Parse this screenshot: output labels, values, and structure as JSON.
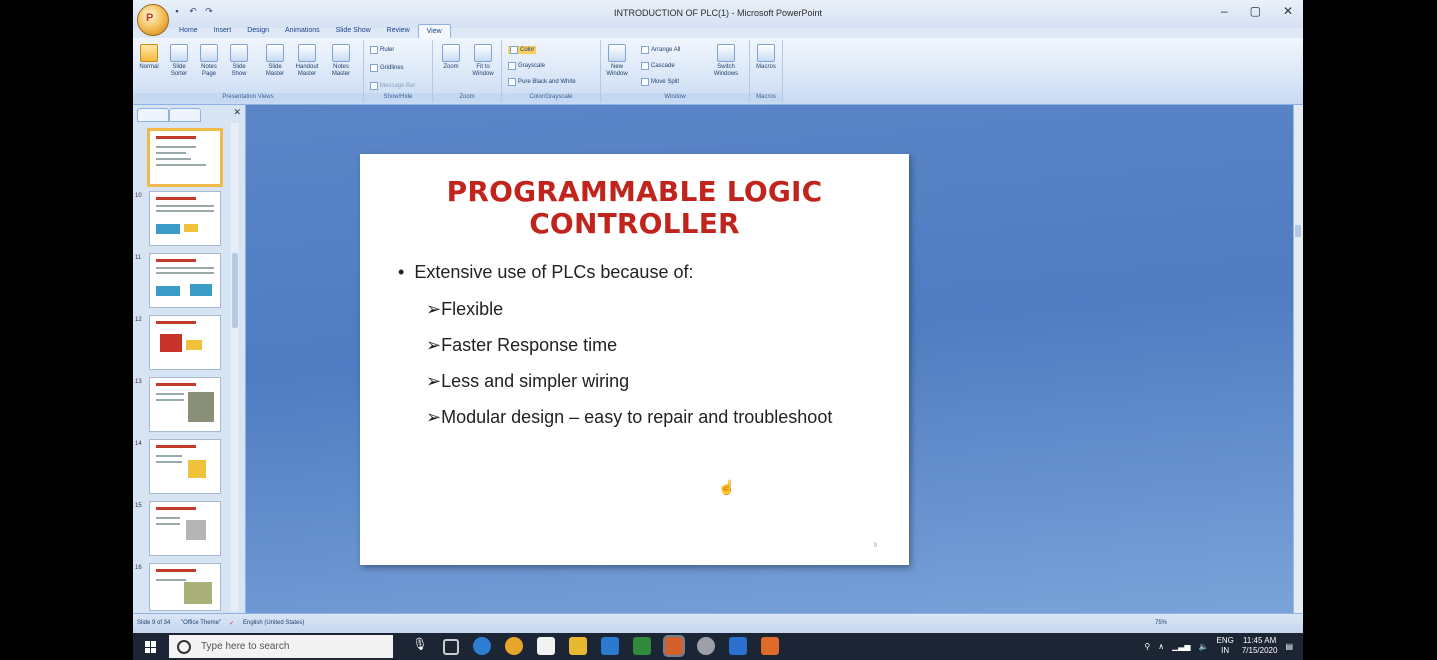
{
  "window": {
    "title": "INTRODUCTION OF PLC(1) - Microsoft PowerPoint",
    "controls": [
      "–",
      "▢",
      "✕"
    ]
  },
  "office_button_label": "P",
  "tabs": [
    "Home",
    "Insert",
    "Design",
    "Animations",
    "Slide Show",
    "Review",
    "View"
  ],
  "ribbon": {
    "presentation_views": {
      "label": "Presentation Views",
      "buttons": [
        "Normal",
        "Slide Sorter",
        "Notes Page",
        "Slide Show",
        "Slide Master",
        "Handout Master",
        "Notes Master"
      ]
    },
    "show_hide": {
      "label": "Show/Hide",
      "items": [
        "Ruler",
        "Gridlines",
        "Message Bar"
      ]
    },
    "zoom": {
      "label": "Zoom",
      "buttons": [
        "Zoom",
        "Fit to Window"
      ]
    },
    "color": {
      "label": "Color/Grayscale",
      "items": [
        "Color",
        "Grayscale",
        "Pure Black and White"
      ]
    },
    "window": {
      "label": "Window",
      "buttons": [
        "New Window",
        "Switch Windows"
      ],
      "items": [
        "Arrange All",
        "Cascade",
        "Move Split"
      ]
    },
    "macros": {
      "label": "Macros",
      "buttons": [
        "Macros"
      ]
    }
  },
  "slide_panel": {
    "thumb_numbers": [
      "",
      "10",
      "11",
      "12",
      "13",
      "14",
      "15",
      "16"
    ]
  },
  "slide": {
    "title": "PROGRAMMABLE LOGIC CONTROLLER",
    "bullet": "Extensive use of PLCs because of:",
    "subpoints": [
      "➢Flexible",
      "➢Faster Response time",
      "➢Less and simpler wiring",
      "➢Modular design – easy to repair and troubleshoot"
    ],
    "number": "9"
  },
  "status_bar": {
    "slide_info": "Slide 9 of 34",
    "theme": "\"Office Theme\"",
    "language": "English (United States)",
    "zoom": "75%"
  },
  "taskbar": {
    "search_placeholder": "Type here to search",
    "lang1": "ENG",
    "lang2": "IN",
    "time": "11:45 AM",
    "date": "7/15/2020"
  }
}
